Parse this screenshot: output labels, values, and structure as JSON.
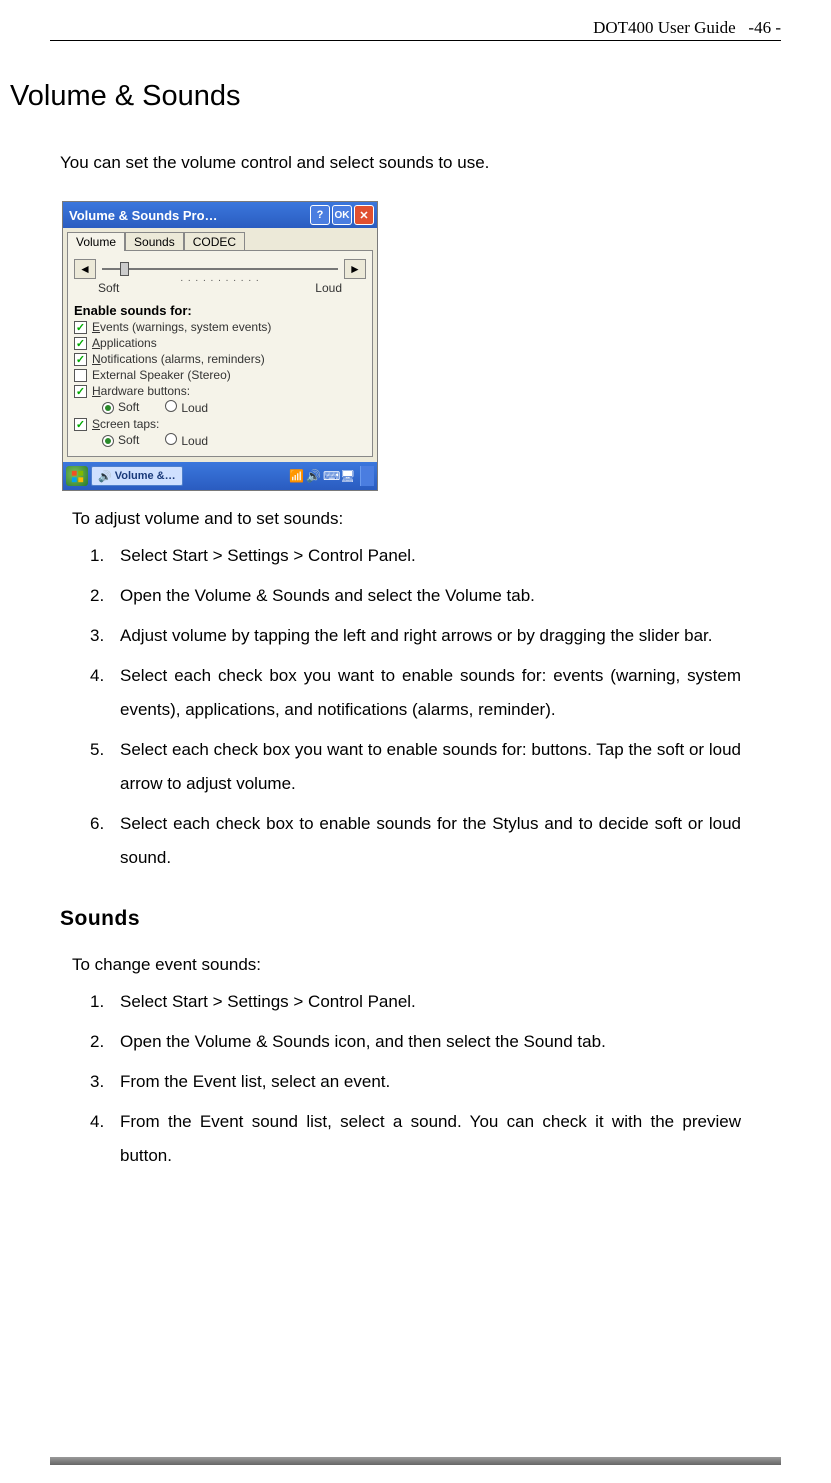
{
  "header": {
    "doc_title": "DOT400 User Guide",
    "page_no": "-46 -"
  },
  "title": "Volume & Sounds",
  "intro": "You can set the volume control and select sounds to use.",
  "win": {
    "title": "Volume & Sounds Pro…",
    "help": "?",
    "ok": "OK",
    "close": "✕",
    "tabs": {
      "t1": "Volume",
      "t2": "Sounds",
      "t3": "CODEC"
    },
    "slider": {
      "left": "◄",
      "right": "►",
      "soft": "Soft",
      "loud": "Loud"
    },
    "enable_label": "Enable sounds for:",
    "chk1": "Events (warnings, system events)",
    "chk2": "Applications",
    "chk3": "Notifications (alarms, reminders)",
    "chk4": "External Speaker (Stereo)",
    "chk5": "Hardware buttons:",
    "chk6": "Screen taps:",
    "radio_soft": "Soft",
    "radio_loud": "Loud",
    "task_label": "Volume &…"
  },
  "section1": {
    "lead": "To adjust volume and to set sounds:",
    "s1": "Select Start > Settings > Control Panel.",
    "s2": "Open the Volume & Sounds and select the Volume tab.",
    "s3": "Adjust volume by tapping the left and right arrows or by dragging the slider bar.",
    "s4": "Select each check box you want to enable sounds for: events (warning, system events), applications, and notifications (alarms, reminder).",
    "s5": "Select each check box you want to enable sounds for: buttons. Tap the soft or loud arrow to adjust volume.",
    "s6": "Select each check box to enable sounds for the Stylus and to decide soft or loud sound."
  },
  "subheading": "Sounds",
  "section2": {
    "lead": "To change event sounds:",
    "s1": "Select Start > Settings > Control Panel.",
    "s2": "Open the Volume & Sounds icon, and then select the Sound tab.",
    "s3": "From the Event list, select an event.",
    "s4": "From the Event sound list, select a sound. You can check it with the preview button."
  }
}
